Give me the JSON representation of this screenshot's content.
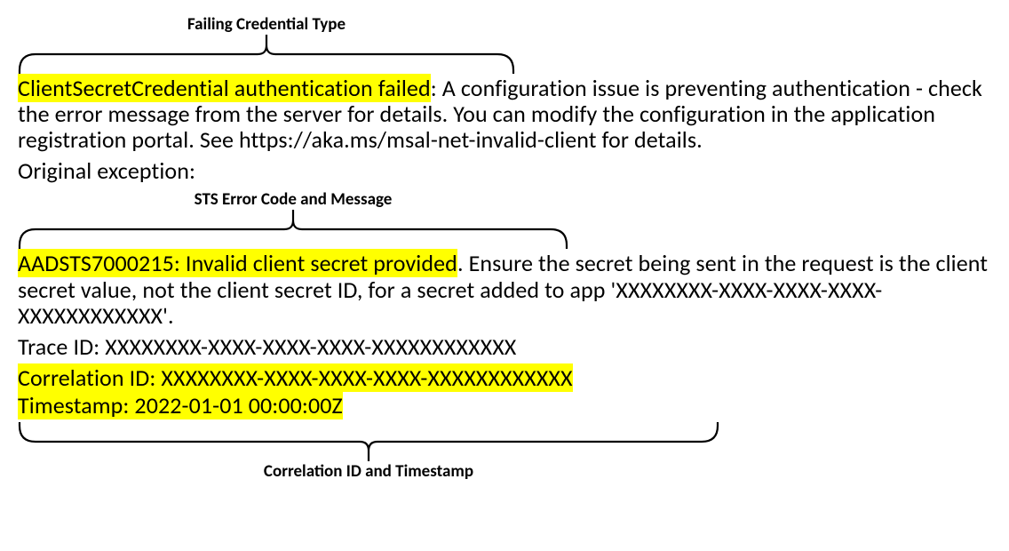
{
  "labels": {
    "top": "Failing Credential Type",
    "middle": "STS Error Code and Message",
    "bottom": "Correlation ID and Timestamp"
  },
  "error": {
    "credential_type_failed": "ClientSecretCredential authentication failed",
    "config_issue_sentence": ": A configuration issue is preventing authentication - check the error message from the server for details. You can modify the configuration in the application registration portal. See https://aka.ms/msal-net-invalid-client for details.",
    "original_exception_label": "Original exception:",
    "sts_code_and_short": "AADSTS7000215: Invalid client secret provided",
    "sts_rest_sentence": ". Ensure the secret being sent in the request is the client secret value, not the client secret ID, for a secret added to app 'XXXXXXXX-XXXX-XXXX-XXXX-XXXXXXXXXXXX'.",
    "trace_id_line": "Trace ID: XXXXXXXX-XXXX-XXXX-XXXX-XXXXXXXXXXXX",
    "correlation_id_line": "Correlation ID: XXXXXXXX-XXXX-XXXX-XXXX-XXXXXXXXXXXX",
    "timestamp_line": "Timestamp: 2022-01-01 00:00:00Z"
  }
}
